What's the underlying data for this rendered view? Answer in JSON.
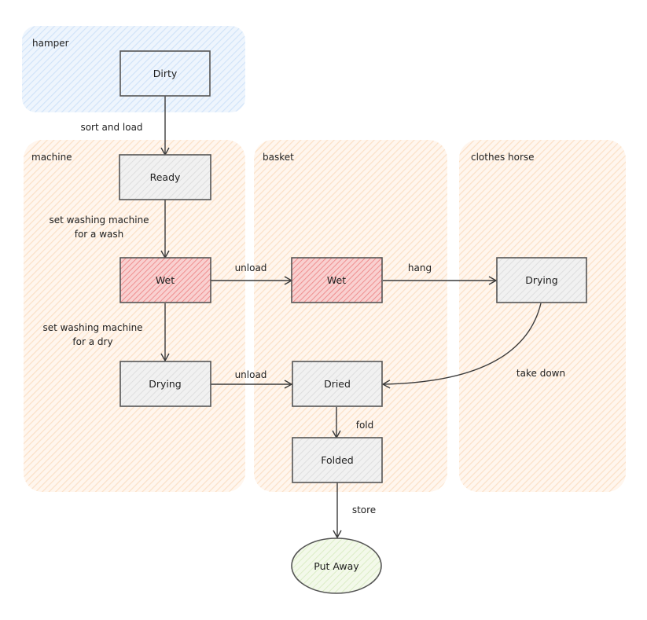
{
  "diagram": {
    "type": "flowchart",
    "style": "hand-drawn",
    "colors": {
      "hamper_fill": "#dcebfa",
      "lane_fill": "#fde6cf",
      "node_fill": "#ececec",
      "wet_fill": "#f4a6a6",
      "terminal_fill": "#e3f2cf",
      "stroke": "#555555"
    },
    "groups": [
      {
        "id": "hamper",
        "label": "hamper"
      },
      {
        "id": "machine",
        "label": "machine"
      },
      {
        "id": "basket",
        "label": "basket"
      },
      {
        "id": "clothes_horse",
        "label": "clothes horse"
      }
    ],
    "nodes": [
      {
        "id": "dirty",
        "label": "Dirty",
        "group": "hamper",
        "shape": "rect"
      },
      {
        "id": "ready",
        "label": "Ready",
        "group": "machine",
        "shape": "rect"
      },
      {
        "id": "wet_machine",
        "label": "Wet",
        "group": "machine",
        "shape": "rect",
        "highlight": true
      },
      {
        "id": "drying_machine",
        "label": "Drying",
        "group": "machine",
        "shape": "rect"
      },
      {
        "id": "wet_basket",
        "label": "Wet",
        "group": "basket",
        "shape": "rect",
        "highlight": true
      },
      {
        "id": "dried",
        "label": "Dried",
        "group": "basket",
        "shape": "rect"
      },
      {
        "id": "folded",
        "label": "Folded",
        "group": "basket",
        "shape": "rect"
      },
      {
        "id": "drying_horse",
        "label": "Drying",
        "group": "clothes_horse",
        "shape": "rect"
      },
      {
        "id": "put_away",
        "label": "Put Away",
        "shape": "ellipse"
      }
    ],
    "edges": [
      {
        "from": "dirty",
        "to": "ready",
        "label": "sort and load"
      },
      {
        "from": "ready",
        "to": "wet_machine",
        "label_lines": [
          "set washing machine",
          "for a wash"
        ]
      },
      {
        "from": "wet_machine",
        "to": "wet_basket",
        "label": "unload"
      },
      {
        "from": "wet_basket",
        "to": "drying_horse",
        "label": "hang"
      },
      {
        "from": "wet_machine",
        "to": "drying_machine",
        "label_lines": [
          "set washing machine",
          "for a dry"
        ]
      },
      {
        "from": "drying_machine",
        "to": "dried",
        "label": "unload"
      },
      {
        "from": "drying_horse",
        "to": "dried",
        "label": "take down"
      },
      {
        "from": "dried",
        "to": "folded",
        "label": "fold"
      },
      {
        "from": "folded",
        "to": "put_away",
        "label": "store"
      }
    ]
  }
}
